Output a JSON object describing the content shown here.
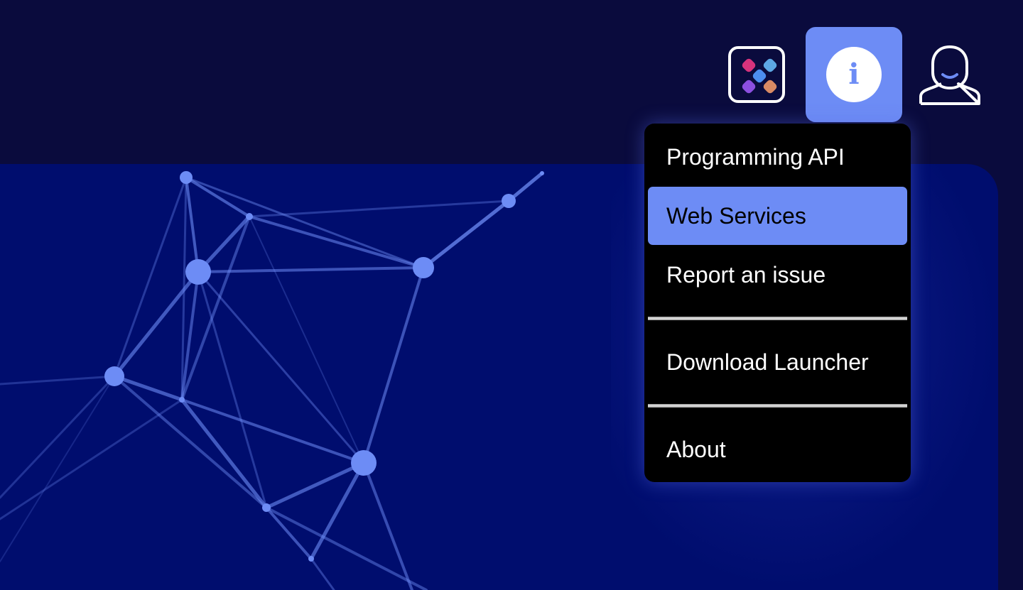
{
  "header": {
    "apps_button": {
      "icon": "apps-grid-icon",
      "dot_colors": [
        "#d6337c",
        "#5da8e4",
        "#4c8ef0",
        "#8c4fe0",
        "#d98a64"
      ]
    },
    "info_button": {
      "icon": "info-icon",
      "glyph": "i",
      "state": "active"
    },
    "user_button": {
      "icon": "user-icon"
    }
  },
  "info_menu": {
    "items": [
      {
        "label": "Programming API"
      },
      {
        "label": "Web Services",
        "highlighted": true
      },
      {
        "label": "Report an issue"
      },
      {
        "label": "Download Launcher"
      },
      {
        "label": "About"
      }
    ]
  },
  "background": {
    "decoration": "network-graph"
  },
  "colors": {
    "header_bg": "#0a0b3d",
    "panel_bg": "#000d6e",
    "accent": "#6d8cf5",
    "menu_bg": "#000000",
    "menu_text": "#ffffff"
  }
}
